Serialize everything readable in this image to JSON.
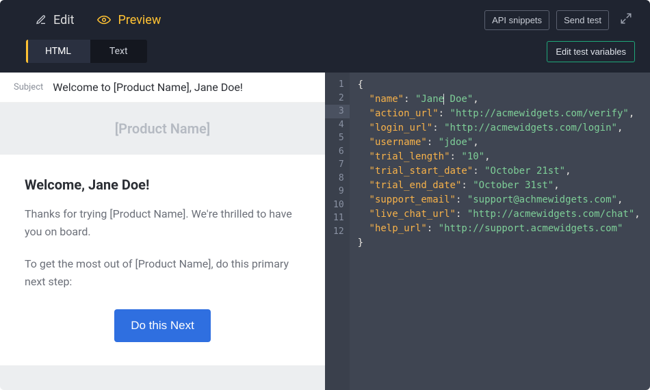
{
  "tabs": {
    "edit": "Edit",
    "preview": "Preview",
    "active": "preview"
  },
  "toolbar": {
    "api_snippets": "API snippets",
    "send_test": "Send test",
    "edit_test_vars": "Edit test variables"
  },
  "modes": {
    "html": "HTML",
    "text": "Text",
    "active": "html"
  },
  "subject": {
    "label": "Subject",
    "value": "Welcome to [Product Name], Jane Doe!"
  },
  "email_preview": {
    "brand": "[Product Name]",
    "heading": "Welcome, Jane Doe!",
    "para1": "Thanks for trying [Product Name]. We're thrilled to have you on board.",
    "para2": "To get the most out of [Product Name], do this primary next step:",
    "cta": "Do this Next"
  },
  "code_vars": {
    "name": "Jane Doe",
    "action_url": "http://acmewidgets.com/verify",
    "login_url": "http://acmewidgets.com/login",
    "username": "jdoe",
    "trial_length": "10",
    "trial_start_date": "October 21st",
    "trial_end_date": "October 31st",
    "support_email": "support@achmewidgets.com",
    "live_chat_url": "http://acmewidgets.com/chat",
    "help_url": "http://support.acmewidgets.com"
  },
  "code_lines": [
    "{",
    "  \"name\": \"Jane Doe\",",
    "  \"action_url\": \"http://acmewidgets.com/verify\",",
    "  \"login_url\": \"http://acmewidgets.com/login\",",
    "  \"username\": \"jdoe\",",
    "  \"trial_length\": \"10\",",
    "  \"trial_start_date\": \"October 21st\",",
    "  \"trial_end_date\": \"October 31st\",",
    "  \"support_email\": \"support@achmewidgets.com\",",
    "  \"live_chat_url\": \"http://acmewidgets.com/chat\",",
    "  \"help_url\": \"http://support.acmewidgets.com\"",
    "}"
  ],
  "cursor_line": 2,
  "highlighted_gutter_line": 3
}
